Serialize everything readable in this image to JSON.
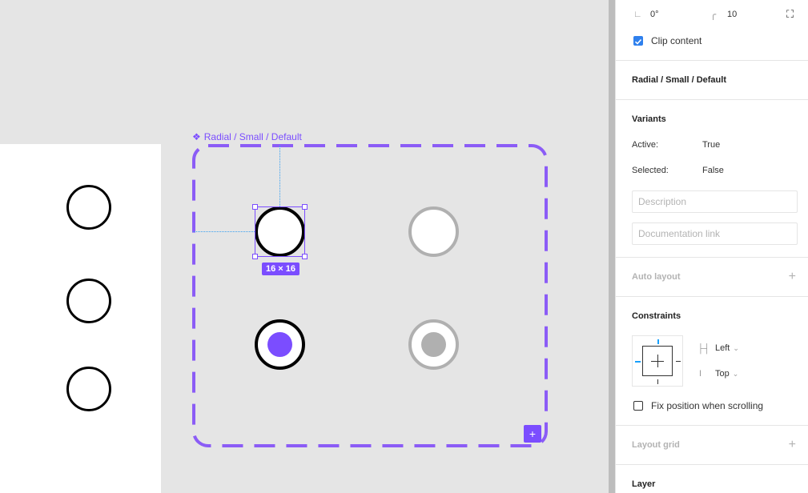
{
  "canvas": {
    "component_label": "Radial / Small / Default",
    "size_badge": "16 × 16",
    "add_variant_symbol": "+",
    "accent_color": "#7b4dff"
  },
  "panel": {
    "rotation": "0°",
    "corner_radius": "10",
    "clip_content": "Clip content",
    "component_name": "Radial / Small / Default",
    "variants": {
      "title": "Variants",
      "active_label": "Active:",
      "active_value": "True",
      "selected_label": "Selected:",
      "selected_value": "False"
    },
    "description_placeholder": "Description",
    "documentation_placeholder": "Documentation link",
    "auto_layout": "Auto layout",
    "constraints": {
      "title": "Constraints",
      "horizontal": "Left",
      "vertical": "Top"
    },
    "fix_position": "Fix position when scrolling",
    "layout_grid": "Layout grid",
    "layer": "Layer",
    "plus": "+"
  }
}
